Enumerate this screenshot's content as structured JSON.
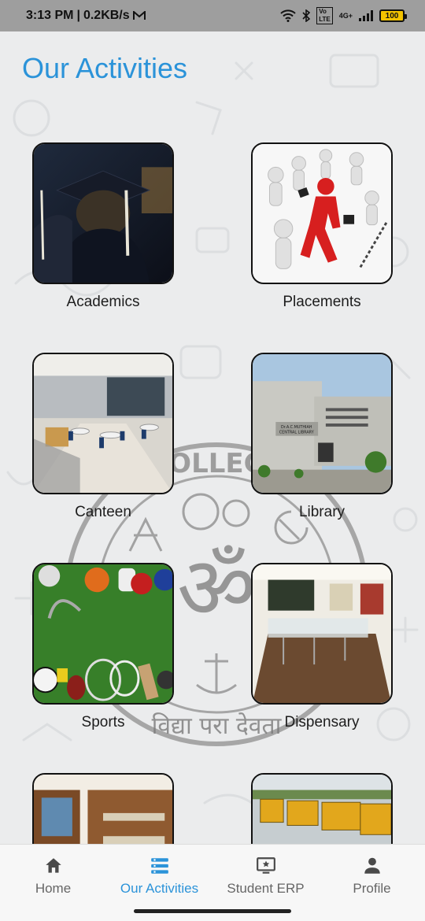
{
  "status_bar": {
    "time": "3:13 PM",
    "speed": "0.2KB/s",
    "mail_icon": "gmail-icon",
    "battery": "100",
    "network": "4G+"
  },
  "page": {
    "title": "Our Activities"
  },
  "activities": [
    {
      "label": "Academics",
      "image": "graduation-cap-photo"
    },
    {
      "label": "Placements",
      "image": "running-businessmen-photo"
    },
    {
      "label": "Canteen",
      "image": "canteen-hall-photo"
    },
    {
      "label": "Library",
      "image": "central-library-building-photo"
    },
    {
      "label": "Sports",
      "image": "sports-equipment-photo"
    },
    {
      "label": "Dispensary",
      "image": "dispensary-interior-photo"
    },
    {
      "label": "",
      "image": "hostel-room-photo"
    },
    {
      "label": "",
      "image": "college-buses-photo"
    }
  ],
  "watermark": {
    "top_text": "COLLEGE",
    "bottom_text": "विद्या परा देवता"
  },
  "bottom_nav": {
    "items": [
      {
        "label": "Home",
        "icon": "home-icon"
      },
      {
        "label": "Our Activities",
        "icon": "list-icon",
        "active": true
      },
      {
        "label": "Student ERP",
        "icon": "monitor-star-icon"
      },
      {
        "label": "Profile",
        "icon": "person-icon"
      }
    ]
  },
  "colors": {
    "accent": "#2b93d9",
    "background": "#ebeced",
    "status_bar": "#9e9e9e"
  }
}
